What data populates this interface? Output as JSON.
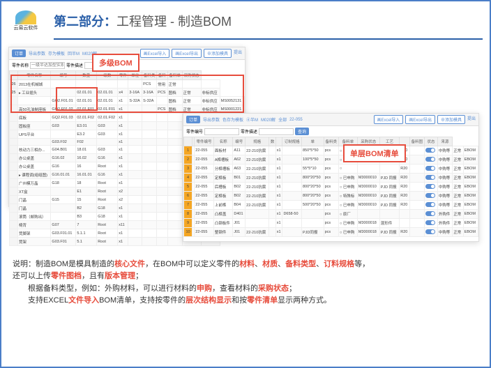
{
  "logo": "云易云软件",
  "title_part": "第二部分：",
  "title_desc": "工程管理 - 制造BOM",
  "callout1": "多级BOM",
  "callout2": "单层BOM清单",
  "window1": {
    "toolbar": [
      "订单",
      "导出参数",
      "存为模板",
      "回半M",
      "M020解"
    ],
    "right": [
      "画Excel导入",
      "画Excel导出",
      "⊕添加模具",
      "提出"
    ],
    "search": {
      "label1": "零件名称",
      "ph": "一级半达加型实现BOM查询条",
      "label2": "零件描述",
      "btn": "查询"
    },
    "headers": [
      "",
      "零件名称",
      "编号",
      "数量",
      "级数",
      "零件",
      "单位",
      "备料类",
      "备料",
      "备料单",
      "采购状态"
    ],
    "rows": [
      [
        "26",
        "2013在机械城",
        "",
        "",
        "",
        "",
        "",
        "PCS",
        "常用",
        "正常",
        "",
        ""
      ],
      [
        "25",
        "▸ 工业插头",
        "",
        "02.01.01",
        "02.01.01",
        "x4",
        "3-16A",
        "3-16A",
        "PCS",
        "图档",
        "正常",
        "非标供应"
      ],
      [
        "",
        "",
        "GQ2.F01.01",
        "02.01.01",
        "02.01.01",
        "x1",
        "S-32A",
        "S-32A",
        "",
        "图档",
        "正常",
        "非标供应",
        "MS0052131"
      ],
      [
        "",
        "高50孔油制座板",
        "GQ2.F01.02",
        "02.01.F01",
        "02.01.F01",
        "x1",
        "",
        "",
        "PCS",
        "图档",
        "正常",
        "非标供应",
        "MS0001221"
      ],
      [
        "",
        "底板",
        "GQ2.F01.03",
        "02.01.F02",
        "02.01.F02",
        "x1",
        "",
        "",
        "",
        "",
        "",
        ""
      ],
      [
        "",
        "固板座",
        "G03",
        "E3.01",
        "G03",
        "x1",
        "",
        "",
        "",
        "",
        "",
        ""
      ],
      [
        "",
        "UPS平台",
        "",
        "E3.2",
        "G03",
        "x1",
        "",
        "",
        "",
        "",
        "",
        ""
      ],
      [
        "",
        "",
        "G03.F02",
        "F02",
        "",
        "x1",
        "",
        "",
        "",
        "",
        "",
        ""
      ],
      [
        "",
        "核动力三相办...",
        "G04.B01",
        "18.01",
        "G03",
        "x1",
        "",
        "",
        "",
        "",
        "",
        ""
      ],
      [
        "",
        "办公桌盖",
        "G16.02",
        "16.02",
        "G16",
        "x1",
        "",
        "",
        "",
        "",
        "",
        ""
      ],
      [
        "",
        "办公桌盖",
        "G16",
        "16",
        "Root",
        "x1",
        "",
        "",
        "",
        "",
        "",
        ""
      ],
      [
        "",
        "▸ 课程调(组组图)",
        "G16.01.01",
        "16.01.01",
        "G16",
        "x1",
        "",
        "",
        "",
        "",
        "",
        ""
      ],
      [
        "",
        "广州模万晶",
        "G18",
        "18",
        "Root",
        "x1",
        "",
        "",
        "",
        "",
        "",
        ""
      ],
      [
        "",
        "XT盒",
        "",
        "E1",
        "Root",
        "x2",
        "",
        "",
        "",
        "",
        "",
        ""
      ],
      [
        "",
        "门晶",
        "G15",
        "15",
        "Root",
        "x2",
        "",
        "",
        "",
        "",
        "",
        ""
      ],
      [
        "",
        "门晶",
        "",
        "B2",
        "G18",
        "x1",
        "",
        "",
        "",
        "",
        "",
        ""
      ],
      [
        "",
        "滚筒（邮购出）",
        "",
        "B3",
        "G18",
        "x1",
        "",
        "",
        "",
        "",
        "",
        ""
      ],
      [
        "",
        "椅背",
        "G07",
        "7",
        "Root",
        "x11",
        "",
        "",
        "",
        "",
        "",
        ""
      ],
      [
        "",
        "凳脚架",
        "G03.F01.01",
        "5.1.1",
        "Root",
        "x1",
        "",
        "",
        "",
        "",
        "",
        ""
      ],
      [
        "",
        "凳架",
        "G03.F01",
        "5.1",
        "Root",
        "x1",
        "",
        "",
        "",
        "",
        "",
        ""
      ]
    ]
  },
  "window2": {
    "toolbar": [
      "订单",
      "导出参数",
      "色存为模板",
      "④半M",
      "M020解",
      "全部",
      "22-055"
    ],
    "right": [
      "画Excel导入",
      "画Excel导出",
      "⊕添加模具",
      "提出"
    ],
    "search": {
      "label1": "零件编号",
      "btn": "查询",
      "label2": "零件描述"
    },
    "headers": [
      "",
      "",
      "零件编号",
      "名称",
      "编号",
      "规格",
      "数",
      "",
      "订制规格",
      "单",
      "备料类",
      "备料单",
      "采购状态",
      "工艺",
      "",
      "备料图",
      "状态",
      "来源"
    ],
    "rows": [
      [
        "1",
        "",
        "22-055",
        "面板材",
        "A11",
        "22-210抗腐",
        "",
        "x1",
        "",
        "850*5*50",
        "pcs",
        "○ 已申购",
        "M3000010",
        "PJD 同报",
        "R20",
        "",
        "",
        "中购等",
        "正常",
        "EBOM"
      ],
      [
        "2",
        "",
        "22-055",
        "A榫槽板",
        "A62",
        "22-210抗腐",
        "",
        "x1",
        "",
        "100*5*50",
        "pcs",
        "○ 已申购",
        "M3000010",
        "PJD 同报",
        "R20",
        "",
        "",
        "中购等",
        "正常",
        "EBOM"
      ],
      [
        "3",
        "",
        "22-055",
        "分榫槽板",
        "A63",
        "22-210抗腐",
        "",
        "x1",
        "",
        "55*5*10",
        "pcs",
        "○",
        "",
        "",
        "R20",
        "",
        "",
        "中购等",
        "正常",
        "EBOM"
      ],
      [
        "4",
        "",
        "22-055",
        "定榫板",
        "B01",
        "22-210抗腐",
        "",
        "x1",
        "",
        "800*20*50",
        "pcs",
        "○ 已申购",
        "M3000010",
        "PJD 同报",
        "R20",
        "",
        "",
        "中购等",
        "正常",
        "EBOM"
      ],
      [
        "5",
        "",
        "22-055",
        "后槽板",
        "B02",
        "22-210抗腐",
        "",
        "x1",
        "",
        "800*20*50",
        "pcs",
        "○ 已申购",
        "M3000010",
        "PJD 同报",
        "R20",
        "",
        "",
        "中购等",
        "正常",
        "EBOM"
      ],
      [
        "6",
        "",
        "22-055",
        "定榫板",
        "B02",
        "22-210抗腐",
        "",
        "x1",
        "",
        "800*20*50",
        "pcs",
        "○ 特殊标",
        "M3000010",
        "PJD 同报",
        "R20",
        "",
        "",
        "中购等",
        "正常",
        "EBOM"
      ],
      [
        "7",
        "",
        "22-055",
        "上前榫",
        "B04",
        "22-210抗腐",
        "",
        "x1",
        "",
        "500*20*50",
        "pcs",
        "○ 已申购",
        "M3000010",
        "PJD 同报",
        "R20",
        "",
        "",
        "中购等",
        "正常",
        "EBOM"
      ],
      [
        "8",
        "",
        "22-055",
        "凸榫盖",
        "D401",
        "",
        "",
        "x1",
        "D658-50",
        "",
        "pcs",
        "○ 原厂",
        "",
        "",
        "",
        "",
        "",
        "外购件",
        "正常",
        "EBOM"
      ],
      [
        "9",
        "",
        "22-055",
        "凸钢板件",
        "J01",
        "",
        "",
        "x1",
        "",
        "",
        "pcs",
        "○ 已申购",
        "M3000018",
        "混形件",
        "",
        "",
        "",
        "外购件",
        "正常",
        "EBOM"
      ],
      [
        "10",
        "",
        "22-055",
        "整钢件",
        "J01",
        "22-210抗腐",
        "",
        "x1",
        "",
        "PJD同报",
        "pcs",
        "○ 已申购",
        "M3000018",
        "PJD 同报",
        "R20",
        "",
        "",
        "中购等",
        "正常",
        "EBOM"
      ]
    ]
  },
  "description": {
    "l1a": "说明：制造BOM是模具制造的",
    "l1b": "核心文件",
    "l1c": "，在BOM中可以定义零件的",
    "l1d": "材料",
    "l1e": "、",
    "l1f": "材质",
    "l1g": "、",
    "l1h": "备料类型",
    "l1i": "、",
    "l1j": "订料规格",
    "l1k": "等，",
    "l2a": "还可以上传",
    "l2b": "零件图档",
    "l2c": "，且有",
    "l2d": "版本管理",
    "l2e": "；",
    "l3a": "　　根据备料类型，例如：外购材料，可以进行材料的",
    "l3b": "申购",
    "l3c": "，查看材料的",
    "l3d": "采购状态",
    "l3e": "；",
    "l4a": "　　支持EXCEL",
    "l4b": "文件导入",
    "l4c": "BOM清单，支持按零件的",
    "l4d": "层次结构显示",
    "l4e": "和按",
    "l4f": "零件清单",
    "l4g": "显示两种方式。"
  }
}
